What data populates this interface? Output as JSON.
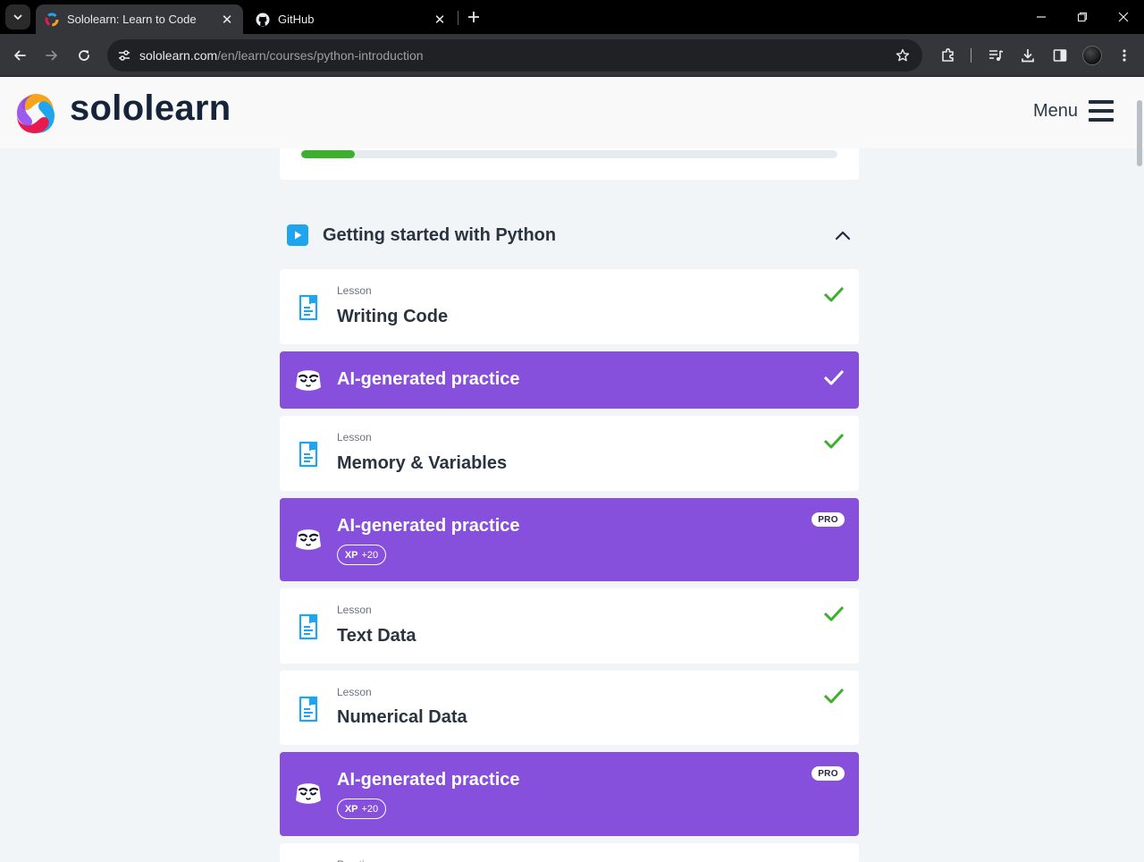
{
  "browser": {
    "tabs": [
      {
        "title": "Sololearn: Learn to Code",
        "active": true
      },
      {
        "title": "GitHub",
        "active": false
      }
    ],
    "url_host": "sololearn.com",
    "url_path": "/en/learn/courses/python-introduction"
  },
  "site": {
    "brand": "sololearn",
    "menu_label": "Menu"
  },
  "course": {
    "progress_fraction": 0.1
  },
  "module": {
    "title": "Getting started with Python",
    "expanded": true
  },
  "items": [
    {
      "kind": "Lesson",
      "name": "Writing Code",
      "type": "lesson",
      "completed": true
    },
    {
      "name": "AI-generated practice",
      "type": "practice",
      "completed": true
    },
    {
      "kind": "Lesson",
      "name": "Memory & Variables",
      "type": "lesson",
      "completed": true
    },
    {
      "name": "AI-generated practice",
      "type": "practice",
      "pro": "PRO",
      "xp_label": "XP",
      "xp_value": "+20"
    },
    {
      "kind": "Lesson",
      "name": "Text Data",
      "type": "lesson",
      "completed": true
    },
    {
      "kind": "Lesson",
      "name": "Numerical Data",
      "type": "lesson",
      "completed": true
    },
    {
      "name": "AI-generated practice",
      "type": "practice",
      "pro": "PRO",
      "xp_label": "XP",
      "xp_value": "+20"
    },
    {
      "kind": "Practice",
      "type": "lesson"
    }
  ],
  "colors": {
    "practice_bg": "#8650dd",
    "check_green": "#3cb02d",
    "lesson_icon_blue": "#1ea5ee",
    "page_bg": "#f2f5f8"
  },
  "icons": {
    "lesson": "lesson-document-icon",
    "practice": "ai-bot-icon",
    "done": "checkmark-icon",
    "module": "play-icon"
  }
}
